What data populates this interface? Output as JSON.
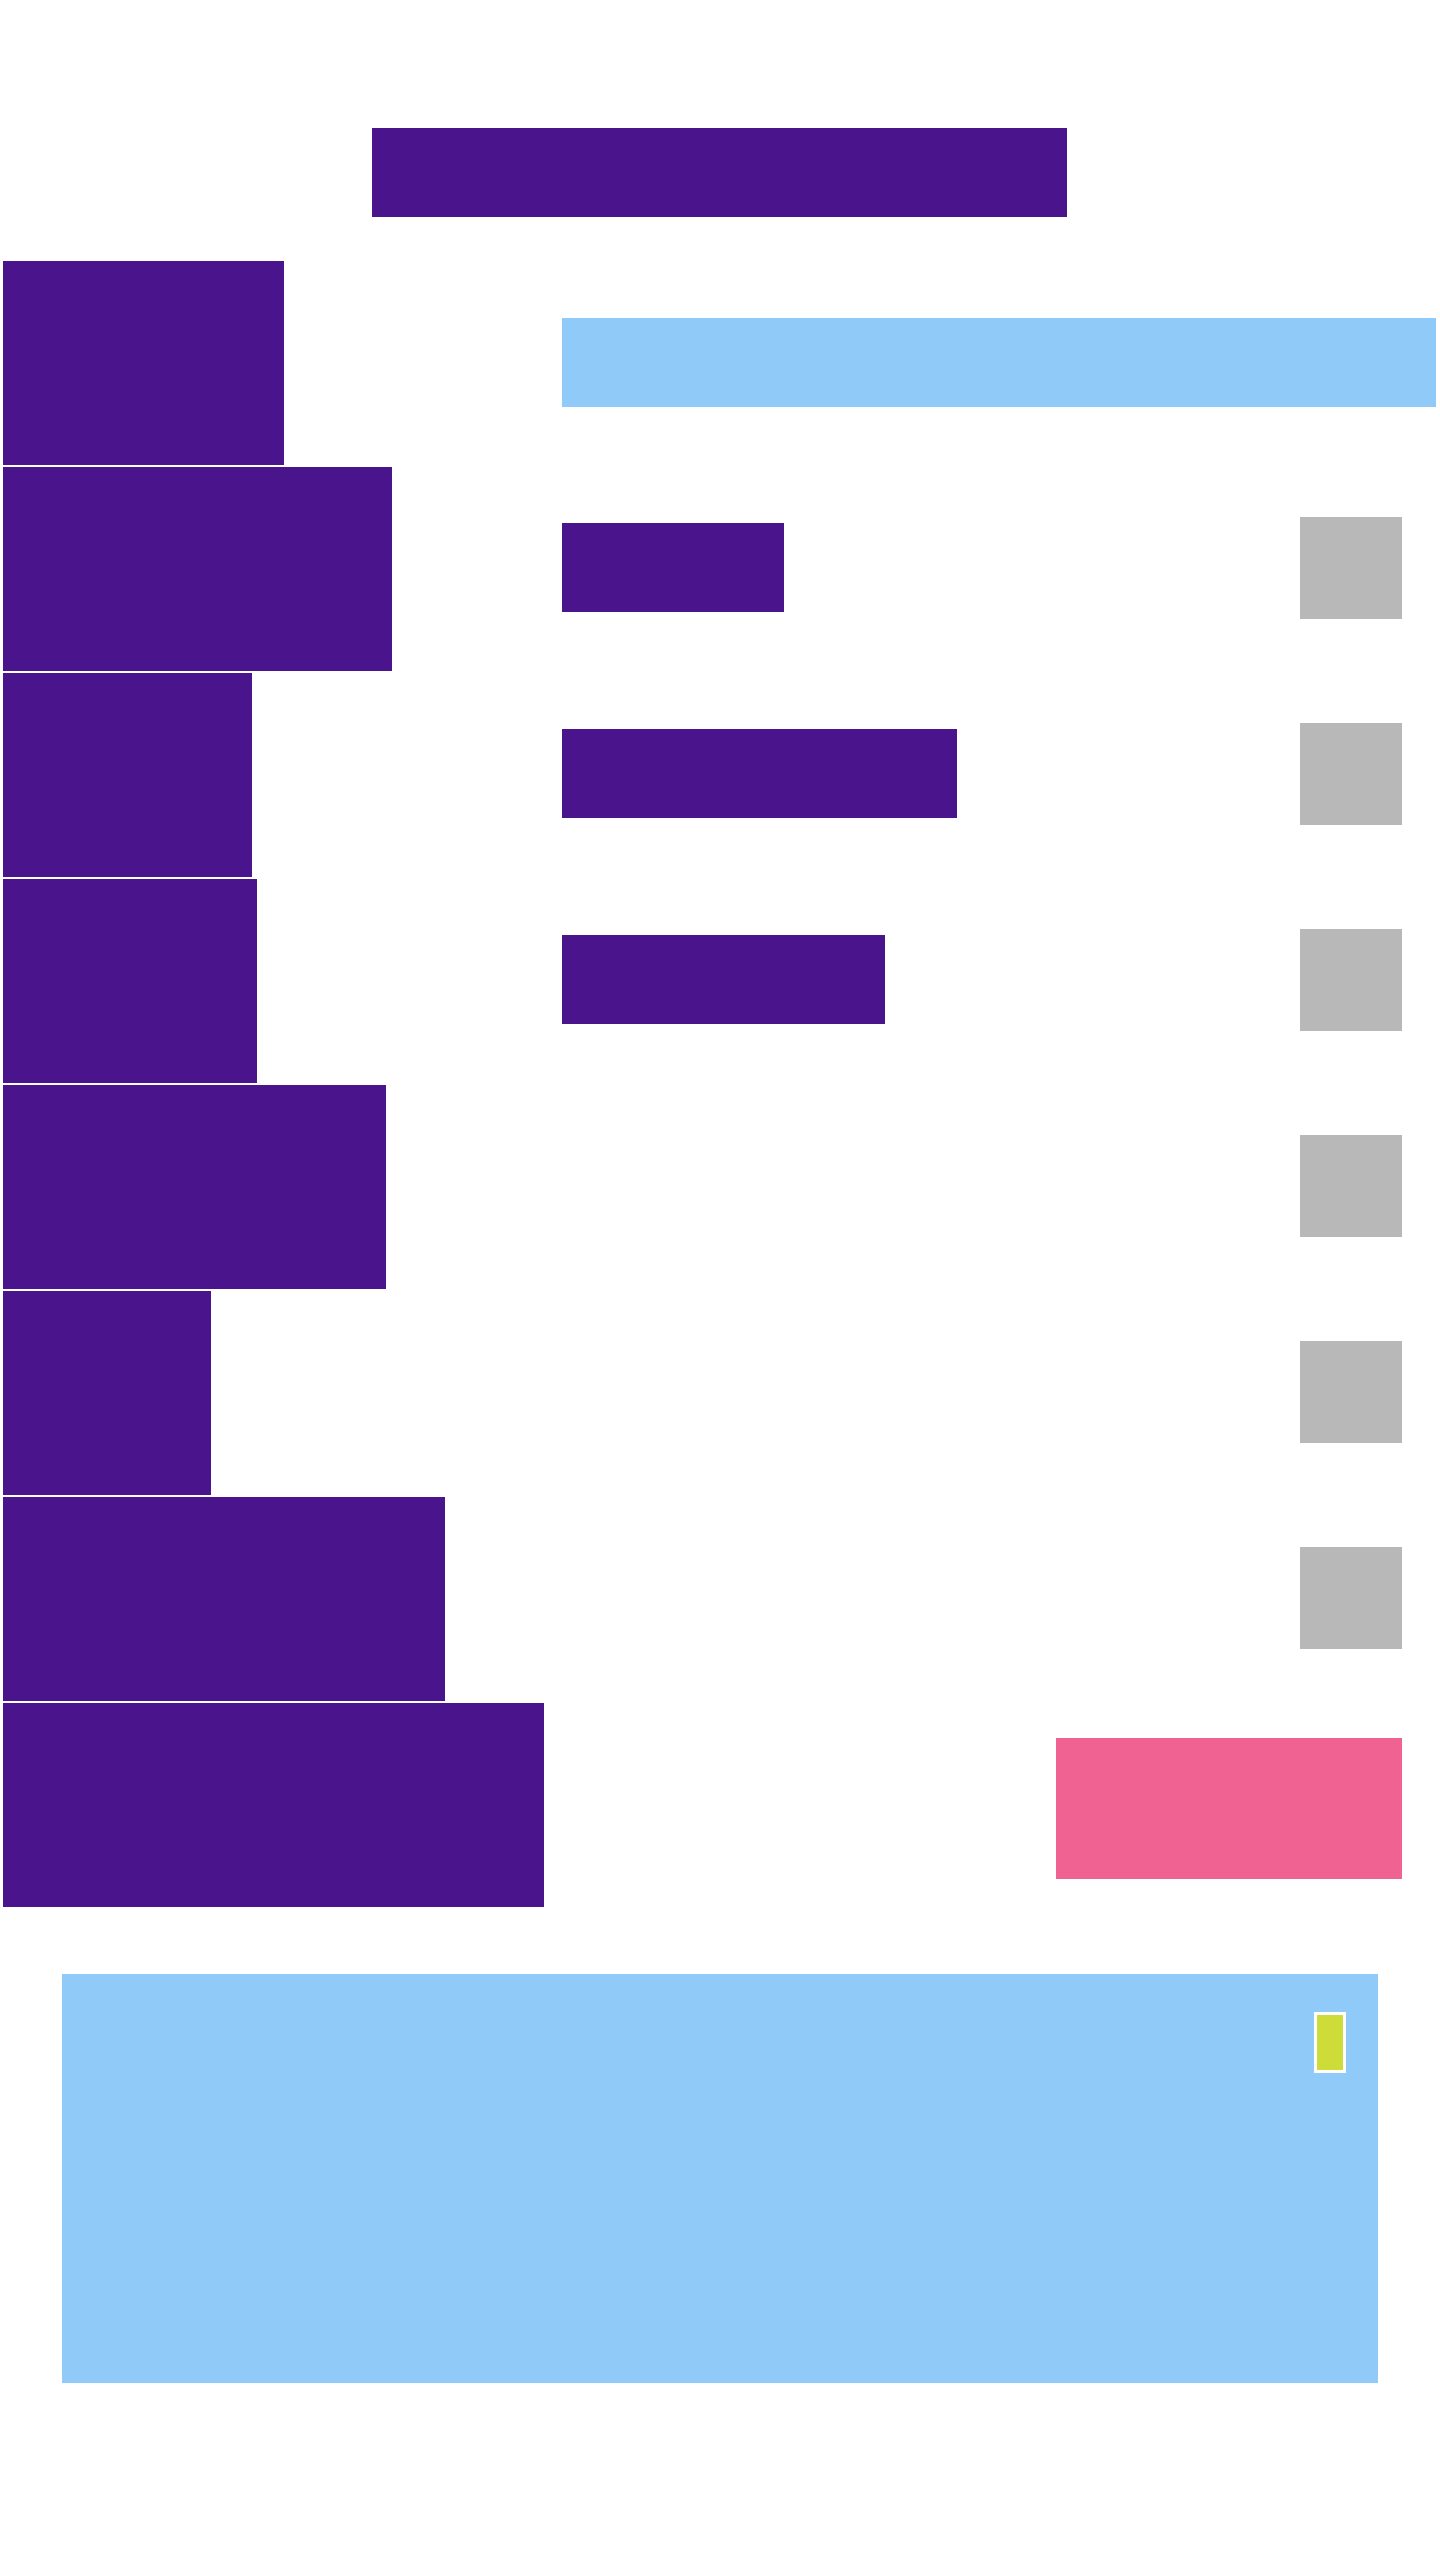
{
  "colors": {
    "primary": "#4a148c",
    "surface": "#90caf9",
    "toggle": "#b8b8b8",
    "accent": "#f06292",
    "indicator": "#cddc39",
    "background": "#ffffff"
  },
  "header": {
    "title": ""
  },
  "sidebar": {
    "items": [
      {
        "label": ""
      },
      {
        "label": ""
      },
      {
        "label": ""
      },
      {
        "label": ""
      },
      {
        "label": ""
      },
      {
        "label": ""
      },
      {
        "label": ""
      },
      {
        "label": ""
      }
    ]
  },
  "search": {
    "value": "",
    "placeholder": ""
  },
  "settings": {
    "rows": [
      {
        "label": "",
        "toggle_icon": "checkbox-square"
      },
      {
        "label": "",
        "toggle_icon": "checkbox-square"
      },
      {
        "label": "",
        "toggle_icon": "checkbox-square"
      },
      {
        "label": "",
        "toggle_icon": "checkbox-square"
      },
      {
        "label": "",
        "toggle_icon": "checkbox-square"
      },
      {
        "label": "",
        "toggle_icon": "checkbox-square"
      }
    ]
  },
  "action": {
    "label": ""
  },
  "panel": {
    "content": "",
    "indicator_icon": "status-marker"
  }
}
